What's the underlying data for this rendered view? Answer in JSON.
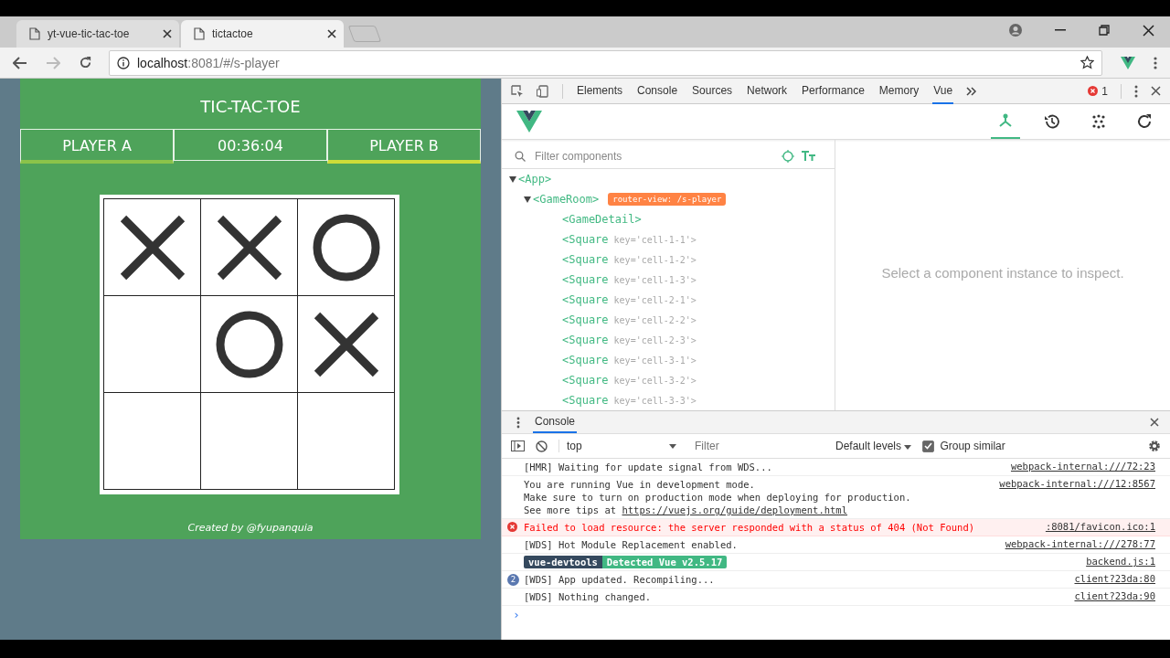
{
  "browser_tabs": [
    {
      "title": "yt-vue-tic-tac-toe",
      "selected": false
    },
    {
      "title": "tictactoe",
      "selected": true
    }
  ],
  "address": {
    "host": "localhost",
    "rest": ":8081/#/s-player"
  },
  "game": {
    "title": "TIC-TAC-TOE",
    "timer": "00:36:04",
    "players": [
      {
        "name": "PLAYER A",
        "selected": false
      },
      {
        "name": "PLAYER B",
        "selected": true
      }
    ],
    "cells": [
      {
        "kind": "x"
      },
      {
        "kind": "x"
      },
      {
        "kind": "o"
      },
      {
        "kind": "empty"
      },
      {
        "kind": "o"
      },
      {
        "kind": "x"
      },
      {
        "kind": "empty"
      },
      {
        "kind": "empty"
      },
      {
        "kind": "empty"
      }
    ],
    "footer": "Created by @fyupanquia"
  },
  "devtools": {
    "tabs": [
      {
        "label": "Elements",
        "selected": false
      },
      {
        "label": "Console",
        "selected": false
      },
      {
        "label": "Sources",
        "selected": false
      },
      {
        "label": "Network",
        "selected": false
      },
      {
        "label": "Performance",
        "selected": false
      },
      {
        "label": "Memory",
        "selected": false
      },
      {
        "label": "Vue",
        "selected": true
      }
    ],
    "error_count": "1",
    "filter_placeholder": "Filter components",
    "tree": [
      {
        "label": "<App>",
        "expanded": true,
        "children": [
          {
            "label": "<GameRoom>",
            "expanded": true,
            "badge": "router-view: /s-player",
            "children": [
              {
                "label": "<GameDetail>"
              },
              {
                "label": "<Square",
                "attrs": "key='cell-1-1'>"
              },
              {
                "label": "<Square",
                "attrs": "key='cell-1-2'>"
              },
              {
                "label": "<Square",
                "attrs": "key='cell-1-3'>"
              },
              {
                "label": "<Square",
                "attrs": "key='cell-2-1'>"
              },
              {
                "label": "<Square",
                "attrs": "key='cell-2-2'>"
              },
              {
                "label": "<Square",
                "attrs": "key='cell-2-3'>"
              },
              {
                "label": "<Square",
                "attrs": "key='cell-3-1'>"
              },
              {
                "label": "<Square",
                "attrs": "key='cell-3-2'>"
              },
              {
                "label": "<Square",
                "attrs": "key='cell-3-3'>"
              }
            ]
          }
        ]
      }
    ],
    "inspect_hint": "Select a component instance to inspect.",
    "console": {
      "title": "Console",
      "context": "top",
      "filter_placeholder": "Filter",
      "levels": "Default levels",
      "group_similar": {
        "label": "Group similar",
        "checked": true
      },
      "messages": [
        {
          "kind": "log",
          "lines": [
            "[HMR] Waiting for update signal from WDS..."
          ],
          "source": "webpack-internal:///72:23"
        },
        {
          "kind": "log",
          "lines": [
            "You are running Vue in development mode.",
            "Make sure to turn on production mode when deploying for production."
          ],
          "link_prefix": "See more tips at ",
          "link": "https://vuejs.org/guide/deployment.html",
          "source": "webpack-internal:///12:8567"
        },
        {
          "kind": "error",
          "lines": [
            "Failed to load resource: the server responded with a status of 404 (Not Found)"
          ],
          "source": ":8081/favicon.ico:1"
        },
        {
          "kind": "log",
          "lines": [
            "[WDS] Hot Module Replacement enabled."
          ],
          "source": "webpack-internal:///278:77"
        },
        {
          "kind": "badge",
          "badges": [
            "vue-devtools",
            "Detected Vue v2.5.17"
          ],
          "source": "backend.js:1"
        },
        {
          "kind": "log",
          "count": "2",
          "lines": [
            "[WDS] App updated. Recompiling..."
          ],
          "source": "client?23da:80"
        },
        {
          "kind": "log",
          "lines": [
            "[WDS] Nothing changed."
          ],
          "source": "client?23da:90"
        }
      ],
      "prompt": "›"
    }
  }
}
